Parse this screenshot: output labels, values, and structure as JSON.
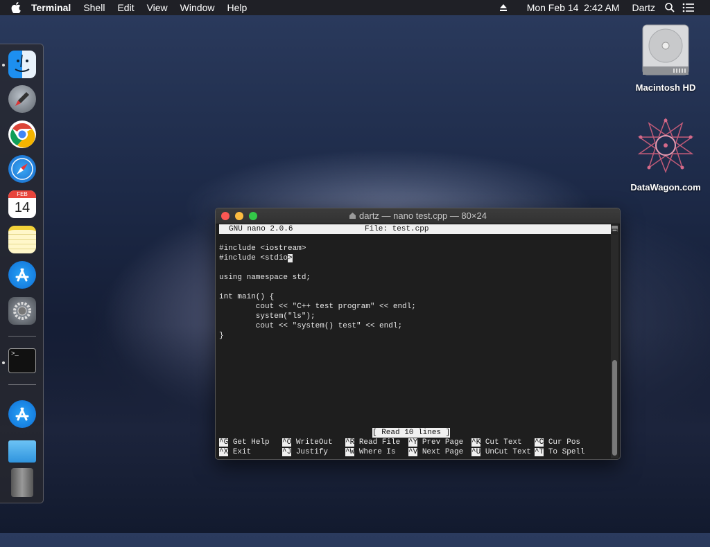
{
  "menubar": {
    "app_name": "Terminal",
    "menus": [
      "Shell",
      "Edit",
      "View",
      "Window",
      "Help"
    ],
    "datetime": "Mon Feb 14  2:42 AM",
    "user": "Dartz"
  },
  "desktop": {
    "icons": [
      {
        "label": "Macintosh HD",
        "icon": "hard-drive-icon"
      },
      {
        "label": "DataWagon.com",
        "icon": "datawagon-logo-icon"
      }
    ]
  },
  "dock": {
    "items": [
      "finder-icon",
      "launchpad-icon",
      "chrome-icon",
      "safari-icon",
      "calendar-icon",
      "notes-icon",
      "app-store-icon",
      "system-preferences-icon",
      "terminal-icon",
      "app-store-download-icon",
      "folder-icon",
      "trash-icon"
    ],
    "calendar": {
      "month": "FEB",
      "day": "14"
    },
    "terminal_prompt": ">_"
  },
  "terminal": {
    "title": "dartz — nano test.cpp — 80×24",
    "nano_version": "GNU nano 2.0.6",
    "file_label": "File: test.cpp",
    "code": [
      "#include <iostream>",
      "#include <stdio",
      "",
      "using namespace std;",
      "",
      "int main() {",
      "        cout << \"C++ test program\" << endl;",
      "        system(\"ls\");",
      "        cout << \"system() test\" << endl;",
      "}"
    ],
    "cursor_char": ">",
    "status": "[ Read 10 lines ]",
    "shortcuts_row1": [
      {
        "key": "^G",
        "label": "Get Help"
      },
      {
        "key": "^O",
        "label": "WriteOut"
      },
      {
        "key": "^R",
        "label": "Read File"
      },
      {
        "key": "^Y",
        "label": "Prev Page"
      },
      {
        "key": "^K",
        "label": "Cut Text"
      },
      {
        "key": "^C",
        "label": "Cur Pos"
      }
    ],
    "shortcuts_row2": [
      {
        "key": "^X",
        "label": "Exit"
      },
      {
        "key": "^J",
        "label": "Justify"
      },
      {
        "key": "^W",
        "label": "Where Is"
      },
      {
        "key": "^V",
        "label": "Next Page"
      },
      {
        "key": "^U",
        "label": "UnCut Text"
      },
      {
        "key": "^T",
        "label": "To Spell"
      }
    ]
  },
  "colors": {
    "close": "#fc5753",
    "minimize": "#fdbc40",
    "zoom": "#33c748"
  }
}
